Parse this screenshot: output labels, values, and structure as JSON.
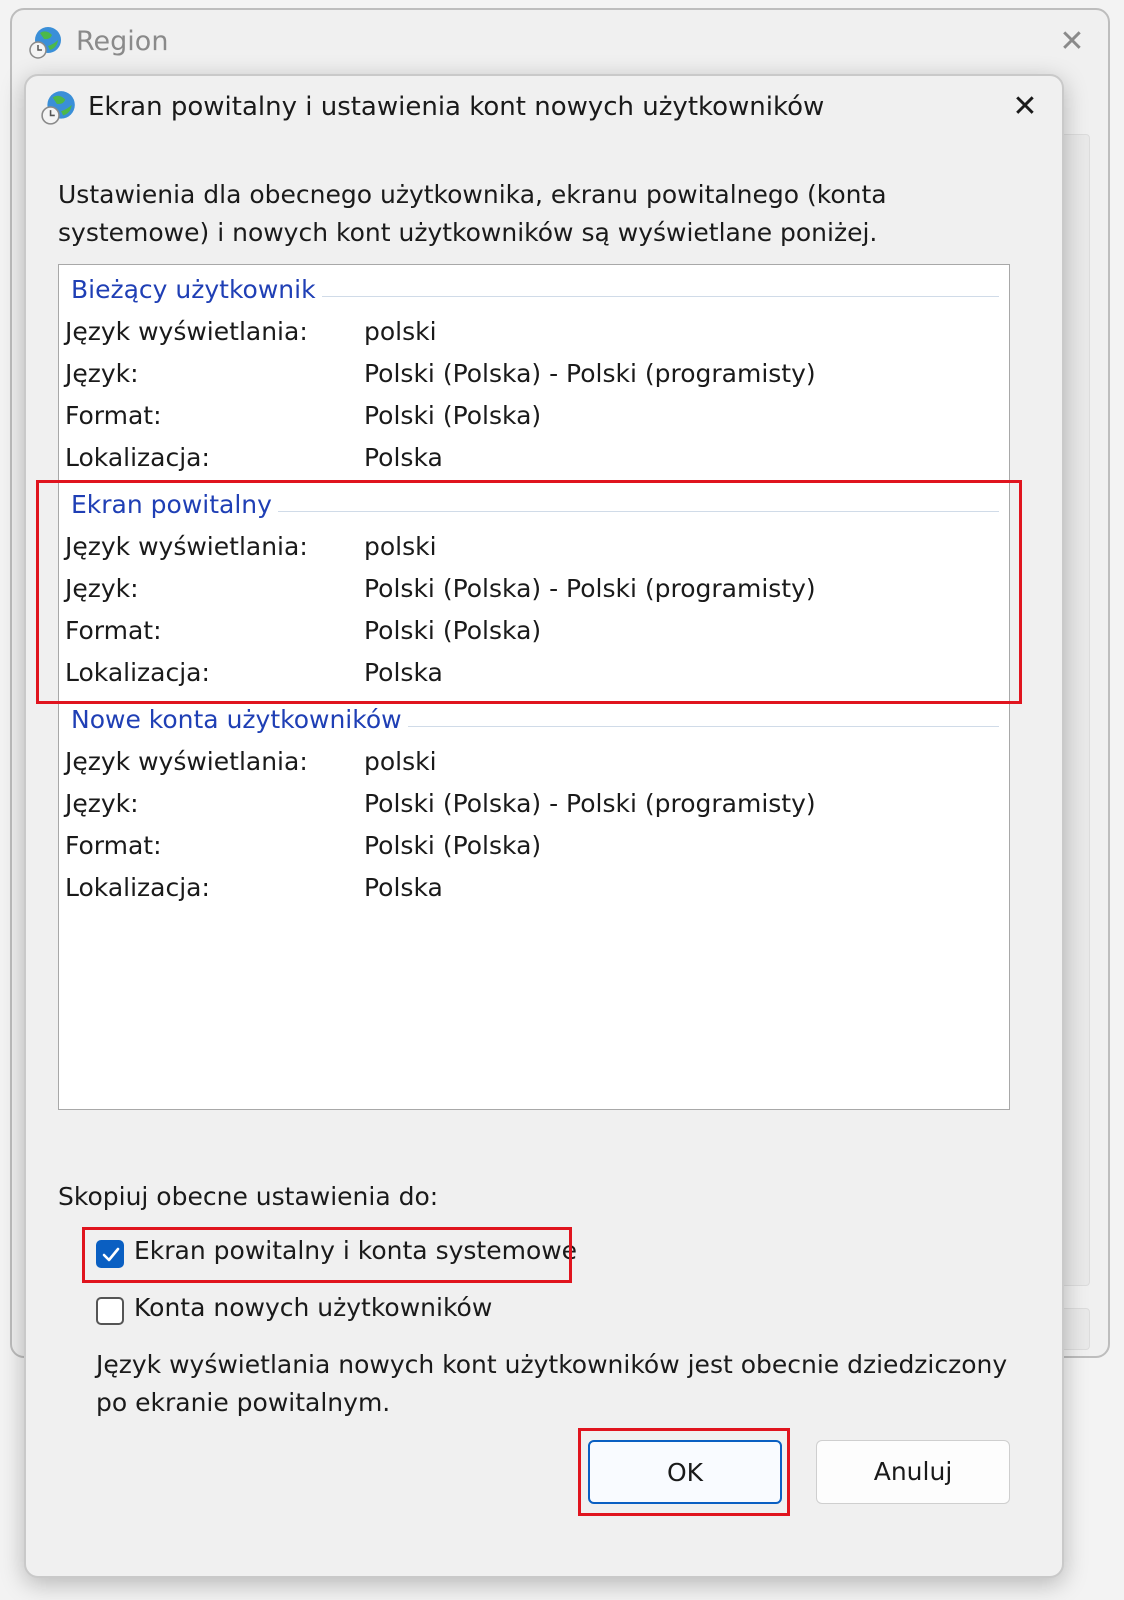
{
  "background_window": {
    "title": "Region"
  },
  "dialog": {
    "title": "Ekran powitalny i ustawienia kont nowych użytkowników",
    "intro": "Ustawienia dla obecnego użytkownika, ekranu powitalnego (konta systemowe) i nowych kont użytkowników są wyświetlane poniżej.",
    "groups": [
      {
        "title": "Bieżący użytkownik",
        "rows": [
          {
            "label": "Język wyświetlania:",
            "value": "polski"
          },
          {
            "label": "Język:",
            "value": "Polski (Polska) - Polski (programisty)"
          },
          {
            "label": "Format:",
            "value": "Polski (Polska)"
          },
          {
            "label": "Lokalizacja:",
            "value": "Polska"
          }
        ]
      },
      {
        "title": "Ekran powitalny",
        "rows": [
          {
            "label": "Język wyświetlania:",
            "value": "polski"
          },
          {
            "label": "Język:",
            "value": "Polski (Polska) - Polski (programisty)"
          },
          {
            "label": "Format:",
            "value": "Polski (Polska)"
          },
          {
            "label": "Lokalizacja:",
            "value": "Polska"
          }
        ]
      },
      {
        "title": "Nowe konta użytkowników",
        "rows": [
          {
            "label": "Język wyświetlania:",
            "value": "polski"
          },
          {
            "label": "Język:",
            "value": "Polski (Polska) - Polski (programisty)"
          },
          {
            "label": "Format:",
            "value": "Polski (Polska)"
          },
          {
            "label": "Lokalizacja:",
            "value": "Polska"
          }
        ]
      }
    ],
    "copy_label": "Skopiuj obecne ustawienia do:",
    "checkboxes": [
      {
        "label": "Ekran powitalny i konta systemowe",
        "checked": true
      },
      {
        "label": "Konta nowych użytkowników",
        "checked": false
      }
    ],
    "note": "Język wyświetlania nowych kont użytkowników jest obecnie dziedziczony po ekranie powitalnym.",
    "ok_label": "OK",
    "cancel_label": "Anuluj"
  },
  "icons": {
    "window_icon": "globe-clock-icon",
    "close": "close-icon",
    "checkmark": "checkmark-icon"
  },
  "colors": {
    "group_title": "#1f3fb5",
    "highlight": "#e0141e",
    "accent": "#0a5fc2"
  }
}
